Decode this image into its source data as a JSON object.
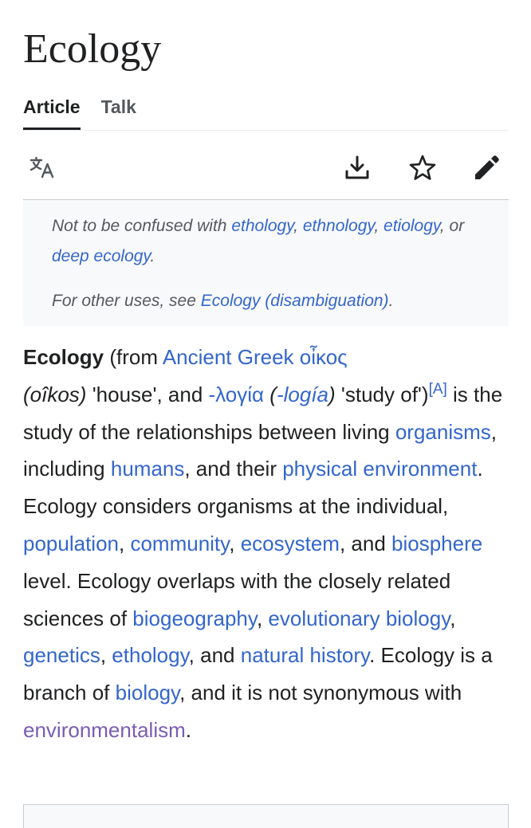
{
  "article": {
    "title": "Ecology"
  },
  "tabs": [
    {
      "label": "Article",
      "active": true
    },
    {
      "label": "Talk",
      "active": false
    }
  ],
  "toolbar": {
    "icons": [
      "language-icon",
      "download-icon",
      "star-icon",
      "edit-icon"
    ]
  },
  "hatnotes": {
    "confused": {
      "prefix": "Not to be confused with ",
      "link1": "ethology",
      "sep1": ", ",
      "link2": "ethnology",
      "sep2": ", ",
      "link3": "etiology",
      "sep3": ", or",
      "link4": "deep ecology",
      "end": "."
    },
    "other_uses": {
      "prefix": "For other uses, see ",
      "link": "Ecology (disambiguation)",
      "end": "."
    }
  },
  "lead": {
    "bold": "Ecology",
    "t1": " (from ",
    "l_ancient_greek": "Ancient Greek",
    "t2": " ",
    "l_oikos": "οἶκος",
    "t3": " ",
    "i_oikos": "(oîkos)",
    "t4": " 'house', and ",
    "l_logia": "-λογία",
    "t5": " ",
    "i_logia_open": "(",
    "l_logia_latin": "-logía",
    "i_logia_close": ")",
    "t6": " 'study of')",
    "ref": "[A]",
    "t7": " is the study of the relationships between living ",
    "l_organisms": "organisms",
    "t8": ", including ",
    "l_humans": "humans",
    "t9": ", and their ",
    "l_phys_env": "physical environment",
    "t10": ". Ecology considers organisms at the individual, ",
    "l_population": "population",
    "t11": ", ",
    "l_community": "community",
    "t12": ", ",
    "l_ecosystem": "ecosystem",
    "t13": ", and ",
    "l_biosphere": "biosphere",
    "t14": " level. Ecology overlaps with the closely related sciences of ",
    "l_biogeography": "biogeography",
    "t15": ", ",
    "l_evo_bio": "evolutionary biology",
    "t16": ", ",
    "l_genetics": "genetics",
    "t17": ", ",
    "l_ethology": "ethology",
    "t18": ", and ",
    "l_natural_history": "natural history",
    "t19": ". Ecology is a branch of ",
    "l_biology": "biology",
    "t20": ", and it is not synonymous with ",
    "l_environmentalism": "environmentalism",
    "t21": "."
  },
  "colors": {
    "link": "#3366cc",
    "visited_link": "#795cb2",
    "text": "#202122",
    "hatnote_bg": "#f8f9fa"
  }
}
